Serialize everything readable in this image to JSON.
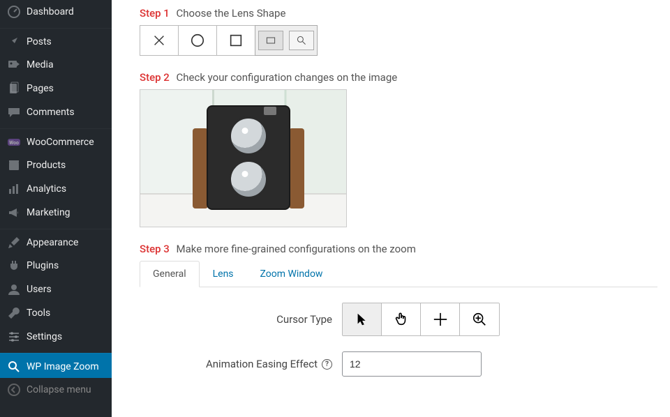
{
  "sidebar": {
    "items": [
      {
        "label": "Dashboard",
        "active": false
      },
      {
        "label": "Posts",
        "active": false
      },
      {
        "label": "Media",
        "active": false
      },
      {
        "label": "Pages",
        "active": false
      },
      {
        "label": "Comments",
        "active": false
      },
      {
        "label": "WooCommerce",
        "active": false
      },
      {
        "label": "Products",
        "active": false
      },
      {
        "label": "Analytics",
        "active": false
      },
      {
        "label": "Marketing",
        "active": false
      },
      {
        "label": "Appearance",
        "active": false
      },
      {
        "label": "Plugins",
        "active": false
      },
      {
        "label": "Users",
        "active": false
      },
      {
        "label": "Tools",
        "active": false
      },
      {
        "label": "Settings",
        "active": false
      },
      {
        "label": "WP Image Zoom",
        "active": true
      }
    ],
    "collapse_label": "Collapse menu"
  },
  "steps": {
    "s1": {
      "num": "Step 1",
      "text": "Choose the Lens Shape"
    },
    "s2": {
      "num": "Step 2",
      "text": "Check your configuration changes on the image"
    },
    "s3": {
      "num": "Step 3",
      "text": "Make more fine-grained configurations on the zoom"
    }
  },
  "lens_shapes": {
    "selected_index": 3,
    "options": [
      "none",
      "circle",
      "square",
      "window"
    ]
  },
  "tabs": {
    "items": [
      "General",
      "Lens",
      "Zoom Window"
    ],
    "active_index": 0
  },
  "form": {
    "cursor_type": {
      "label": "Cursor Type",
      "options": [
        "default",
        "pointer",
        "crosshair",
        "zoom-in"
      ],
      "selected_index": 0
    },
    "easing": {
      "label": "Animation Easing Effect",
      "value": "12"
    }
  }
}
